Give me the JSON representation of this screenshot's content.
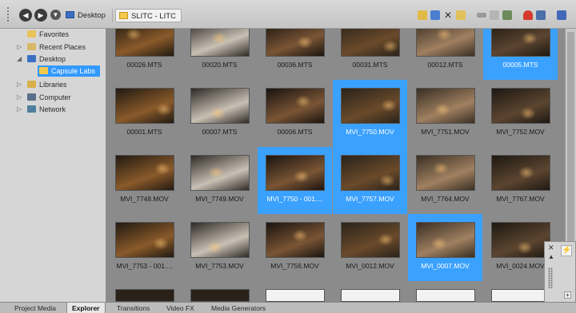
{
  "toolbar": {
    "breadcrumb": [
      {
        "label": "Desktop",
        "icon": "desktop-icon"
      },
      {
        "label": "SLITC - LITC",
        "icon": "folder-icon"
      }
    ],
    "icons": [
      "up-folder-icon",
      "refresh-icon",
      "delete-icon",
      "new-folder-icon",
      "cut-icon",
      "copy-icon",
      "settings-icon",
      "record-icon",
      "search-icon",
      "view-icon"
    ]
  },
  "tree": {
    "items": [
      {
        "label": "Favorites",
        "icon": "star-folder-icon",
        "selected": false
      },
      {
        "label": "Recent Places",
        "icon": "recent-places-icon",
        "selected": false
      },
      {
        "label": "Desktop",
        "icon": "desktop-icon",
        "selected": false
      },
      {
        "label": "Capsule Labs",
        "icon": "folder-icon",
        "selected": true
      },
      {
        "label": "Libraries",
        "icon": "libraries-icon",
        "selected": false
      },
      {
        "label": "Computer",
        "icon": "computer-icon",
        "selected": false
      },
      {
        "label": "Network",
        "icon": "network-icon",
        "selected": false
      }
    ]
  },
  "files": [
    {
      "name": "00026.MTS",
      "selected": false
    },
    {
      "name": "00020.MTS",
      "selected": false
    },
    {
      "name": "00036.MTS",
      "selected": false
    },
    {
      "name": "00031.MTS",
      "selected": false
    },
    {
      "name": "00012.MTS",
      "selected": false
    },
    {
      "name": "00005.MTS",
      "selected": true
    },
    {
      "name": "00001.MTS",
      "selected": false
    },
    {
      "name": "00007.MTS",
      "selected": false
    },
    {
      "name": "00006.MTS",
      "selected": false
    },
    {
      "name": "MVI_7750.MOV",
      "selected": true
    },
    {
      "name": "MVI_7751.MOV",
      "selected": false
    },
    {
      "name": "MVI_7752.MOV",
      "selected": false
    },
    {
      "name": "MVI_7748.MOV",
      "selected": false
    },
    {
      "name": "MVI_7749.MOV",
      "selected": false
    },
    {
      "name": "MVI_7750 - 001....",
      "selected": true
    },
    {
      "name": "MVI_7757.MOV",
      "selected": true
    },
    {
      "name": "MVI_7764.MOV",
      "selected": false
    },
    {
      "name": "MVI_7767.MOV",
      "selected": false
    },
    {
      "name": "MVI_7753 - 001....",
      "selected": false
    },
    {
      "name": "MVI_7753.MOV",
      "selected": false
    },
    {
      "name": "MVI_7756.MOV",
      "selected": false
    },
    {
      "name": "MVI_0012.MOV",
      "selected": false
    },
    {
      "name": "MVI_0007.MOV",
      "selected": true
    },
    {
      "name": "MVI_0024.MOV",
      "selected": false
    }
  ],
  "tabs": [
    {
      "label": "Project Media",
      "active": false
    },
    {
      "label": "Explorer",
      "active": true
    },
    {
      "label": "Transitions",
      "active": false
    },
    {
      "label": "Video FX",
      "active": false
    },
    {
      "label": "Media Generators",
      "active": false
    }
  ],
  "colors": {
    "selection": "#3ba1ff",
    "toolbar": "#d0d0d0",
    "grid": "#8b8b8b"
  }
}
